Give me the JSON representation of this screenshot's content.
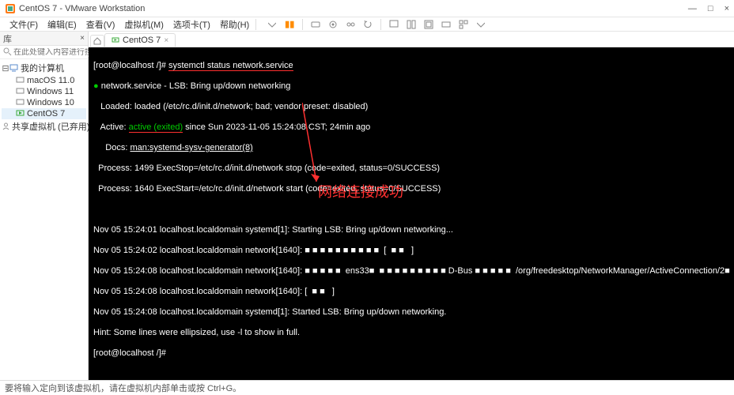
{
  "window": {
    "title": "CentOS 7 - VMware Workstation"
  },
  "win_controls": {
    "min": "—",
    "max": "□",
    "close": "×"
  },
  "menubar": {
    "items": [
      "文件(F)",
      "编辑(E)",
      "查看(V)",
      "虚拟机(M)",
      "选项卡(T)",
      "帮助(H)"
    ]
  },
  "sidebar": {
    "header": "库",
    "search_placeholder": "在此处键入内容进行搜索",
    "root": "我的计算机",
    "children": [
      "macOS 11.0",
      "Windows 11",
      "Windows 10",
      "CentOS 7"
    ],
    "shared": "共享虚拟机 (已弃用)"
  },
  "tabs": {
    "active": "CentOS 7"
  },
  "terminal": {
    "lines": [
      {
        "pre": "[root@localhost /]# ",
        "cmd": "systemctl status network.service",
        "cmd_underline_red": true
      },
      {
        "bullet": true,
        "text": "network.service - LSB: Bring up/down networking"
      },
      {
        "text": "   Loaded: loaded (/etc/rc.d/init.d/network; bad; vendor preset: disabled)"
      },
      {
        "pre": "   Active: ",
        "active": "active (exited)",
        "post": " since Sun 2023-11-05 15:24:08 CST; 24min ago"
      },
      {
        "pre": "     Docs: ",
        "link": "man:systemd-sysv-generator(8)"
      },
      {
        "text": "  Process: 1499 ExecStop=/etc/rc.d/init.d/network stop (code=exited, status=0/SUCCESS)"
      },
      {
        "text": "  Process: 1640 ExecStart=/etc/rc.d/init.d/network start (code=exited, status=0/SUCCESS)"
      }
    ],
    "log": [
      "Nov 05 15:24:01 localhost.localdomain systemd[1]: Starting LSB: Bring up/down networking...",
      "Nov 05 15:24:02 localhost.localdomain network[1640]: ■ ■ ■ ■ ■ ■ ■ ■ ■ ■  [  ■ ■   ]",
      "Nov 05 15:24:08 localhost.localdomain network[1640]: ■ ■ ■ ■ ■  ens33■  ■ ■ ■ ■ ■ ■ ■ ■ ■ D-Bus ■ ■ ■ ■ ■  /org/freedesktop/NetworkManager/ActiveConnection/2■",
      "Nov 05 15:24:08 localhost.localdomain network[1640]: [  ■ ■   ]",
      "Nov 05 15:24:08 localhost.localdomain systemd[1]: Started LSB: Bring up/down networking.",
      "Hint: Some lines were ellipsized, use -l to show in full.",
      "[root@localhost /]# "
    ]
  },
  "annotation": "网络连接成功",
  "statusbar": {
    "text": "要将输入定向到该虚拟机，请在虚拟机内部单击或按 Ctrl+G。"
  }
}
